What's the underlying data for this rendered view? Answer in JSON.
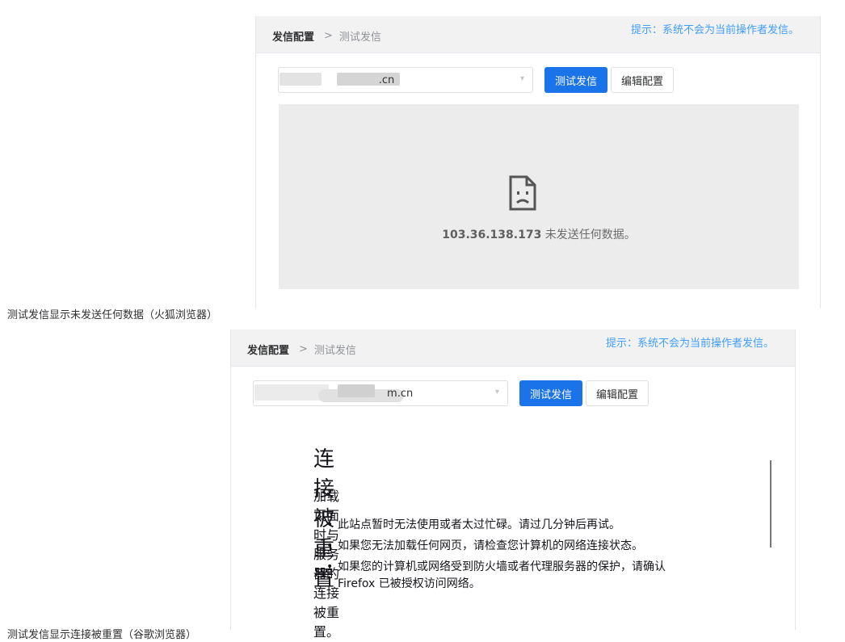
{
  "panel1": {
    "breadcrumb": {
      "item1": "发信配置",
      "separator": ">",
      "item2": "测试发信"
    },
    "hint": "提示：系统不会为当前操作者发信。",
    "select": {
      "value": "                            .cn"
    },
    "buttons": {
      "test": "测试发信",
      "edit": "编辑配置"
    },
    "error": {
      "icon": "sad-document-icon",
      "ip": "103.36.138.173",
      "message": " 未发送任何数据。"
    }
  },
  "caption1": "测试发信显示未发送任何数据（火狐浏览器）",
  "panel2": {
    "breadcrumb": {
      "item1": "发信配置",
      "separator": ">",
      "item2": "测试发信"
    },
    "hint": "提示：系统不会为当前操作者发信。",
    "select": {
      "value": "                                      m.cn"
    },
    "buttons": {
      "test": "测试发信",
      "edit": "编辑配置"
    },
    "error": {
      "title": "连接被重置",
      "subtitle": "加载页面时与服务器的连接被重置。",
      "bullets": [
        "此站点暂时无法使用或者太过忙碌。请过几分钟后再试。",
        "如果您无法加载任何网页，请检查您计算机的网络连接状态。",
        "如果您的计算机或网络受到防火墙或者代理服务器的保护，请确认 Firefox 已被授权访问网络。"
      ]
    }
  },
  "caption2": "测试发信显示连接被重置（谷歌浏览器）",
  "colors": {
    "primary": "#1a73e8",
    "hint": "#409eff",
    "error_bg": "#ececec",
    "topbar_bg": "#f2f2f2"
  }
}
